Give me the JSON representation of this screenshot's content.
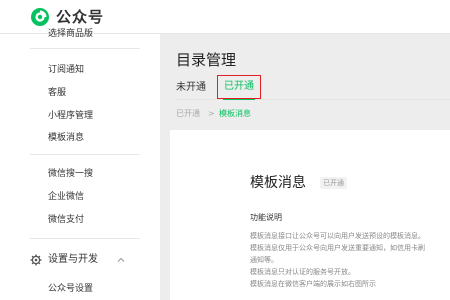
{
  "header": {
    "brand": "公众号"
  },
  "sidebar": {
    "cut_item": "选择商品版",
    "items": [
      "订阅通知",
      "客服",
      "小程序管理",
      "模板消息",
      "微信搜一搜",
      "企业微信",
      "微信支付"
    ],
    "section_label": "设置与开发",
    "section_items": [
      "公众号设置"
    ]
  },
  "main": {
    "page_title": "目录管理",
    "tabs": [
      {
        "label": "未开通"
      },
      {
        "label": "已开通"
      }
    ],
    "breadcrumb": [
      "已开通",
      "模板消息"
    ],
    "breadcrumb_sep": ">",
    "card": {
      "title": "模板消息",
      "badge": "已开通",
      "subtitle": "功能说明",
      "desc_lines": [
        "模板消息接口让公众号可以向用户发送预设的模板消息。",
        "模板消息仅用于公众号向用户发送重要通知，如信用卡刷",
        "通知等。",
        "模板消息只对认证的服务号开放。",
        "模板消息在微信客户端的展示如右图所示"
      ]
    }
  },
  "colors": {
    "accent": "#07c160",
    "highlight_border": "#e02020"
  }
}
